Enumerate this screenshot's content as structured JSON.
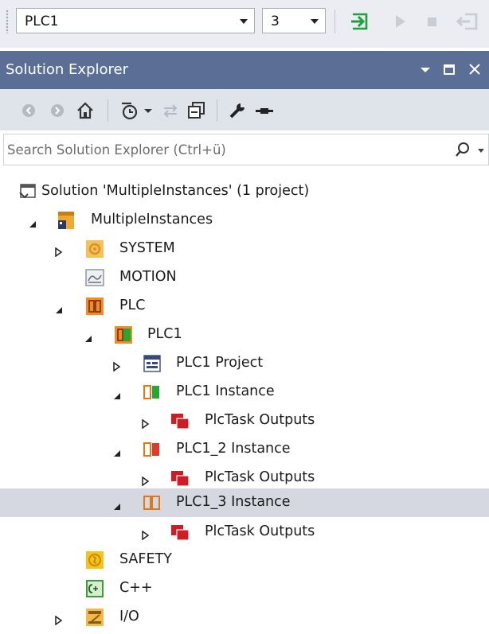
{
  "toolbar": {
    "plc_combo_value": "PLC1",
    "instance_combo_value": "3"
  },
  "solution_explorer": {
    "title": "Solution Explorer",
    "search_placeholder": "Search Solution Explorer (Ctrl+ü)"
  },
  "tree": [
    {
      "label": "Solution 'MultipleInstances' (1 project)",
      "icon": "solution-icon",
      "expander": "none",
      "depth": 0
    },
    {
      "label": "MultipleInstances",
      "icon": "twincat-project-icon",
      "expander": "expanded",
      "depth": 1
    },
    {
      "label": "SYSTEM",
      "icon": "system-icon",
      "expander": "collapsed",
      "depth": 2
    },
    {
      "label": "MOTION",
      "icon": "motion-icon",
      "expander": "none",
      "depth": 2
    },
    {
      "label": "PLC",
      "icon": "plc-folder-icon",
      "expander": "expanded",
      "depth": 2
    },
    {
      "label": "PLC1",
      "icon": "plc-project-icon",
      "expander": "expanded",
      "depth": 3
    },
    {
      "label": "PLC1 Project",
      "icon": "plc-code-project-icon",
      "expander": "collapsed",
      "depth": 4
    },
    {
      "label": "PLC1 Instance",
      "icon": "plc-instance-green-icon",
      "expander": "expanded",
      "depth": 4
    },
    {
      "label": "PlcTask Outputs",
      "icon": "task-outputs-icon",
      "expander": "collapsed",
      "depth": 5
    },
    {
      "label": "PLC1_2 Instance",
      "icon": "plc-instance-red-icon",
      "expander": "expanded",
      "depth": 4
    },
    {
      "label": "PlcTask Outputs",
      "icon": "task-outputs-icon",
      "expander": "collapsed",
      "depth": 5
    },
    {
      "label": "PLC1_3 Instance",
      "icon": "plc-instance-orange-icon",
      "expander": "expanded",
      "depth": 4,
      "selected": true
    },
    {
      "label": "PlcTask Outputs",
      "icon": "task-outputs-icon",
      "expander": "collapsed",
      "depth": 5
    },
    {
      "label": "SAFETY",
      "icon": "safety-icon",
      "expander": "none",
      "depth": 2
    },
    {
      "label": "C++",
      "icon": "cpp-icon",
      "expander": "none",
      "depth": 2
    },
    {
      "label": "I/O",
      "icon": "io-icon",
      "expander": "collapsed",
      "depth": 2
    }
  ],
  "colors": {
    "titlebar": "#5b6f96",
    "selection": "#d5d8e0",
    "activate_green": "#1aa33a",
    "outputs_red": "#d01c24"
  }
}
